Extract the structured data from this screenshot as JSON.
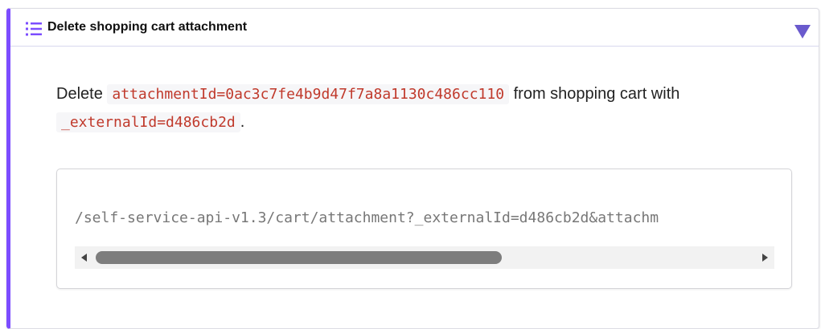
{
  "section": {
    "title": "Delete shopping cart attachment",
    "icon": "numbered-list-icon",
    "toggle_icon": "triangle-down-icon",
    "accent_color": "#7c4dff",
    "icon_color": "#7c4dff",
    "toggle_color": "#6a5acd"
  },
  "description": {
    "prefix": "Delete",
    "attachment_code": "attachmentId=0ac3c7fe4b9d47f7a8a1130c486cc110",
    "middle": "from shopping cart with",
    "external_code": "_externalId=d486cb2d",
    "suffix": "."
  },
  "code_block": {
    "text": "/self-service-api-v1.3/cart/attachment?_externalId=d486cb2d&attachm",
    "scroll_position": 0.0,
    "scroll_visible_fraction": 0.58
  }
}
